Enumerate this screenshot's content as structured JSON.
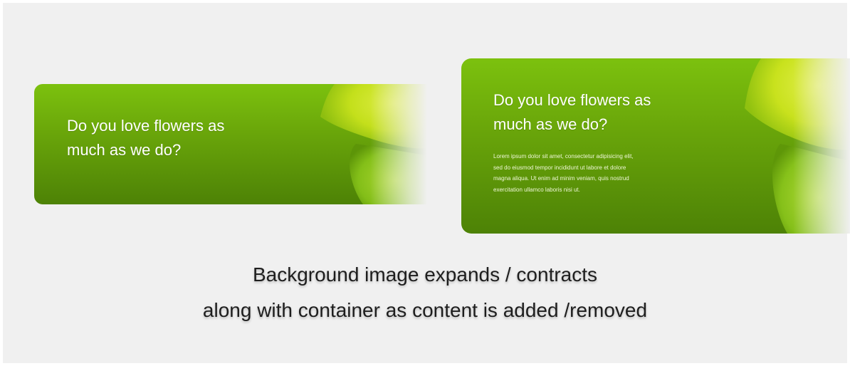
{
  "cards": {
    "small": {
      "title_line1": "Do you love flowers as",
      "title_line2": "much as we do?"
    },
    "large": {
      "title_line1": "Do you love flowers as",
      "title_line2": "much as we do?",
      "body_line1": "Lorem ipsum dolor sit amet, consectetur adipisicing elit,",
      "body_line2": "sed do eiusmod tempor incididunt ut labore et dolore",
      "body_line3": "magna aliqua. Ut enim ad minim veniam, quis nostrud",
      "body_line4": "exercitation ullamco laboris nisi ut."
    }
  },
  "caption": {
    "line1": "Background image expands / contracts",
    "line2": "along with container as content is added /removed"
  },
  "colors": {
    "card_top": "#7cc10e",
    "card_bottom": "#4d8206",
    "flower_petal": "#d6ec2a",
    "stage_bg": "#f0f0f0",
    "caption_text": "#1e1e1e"
  },
  "icons": {
    "card_background": "flower-image-icon"
  }
}
